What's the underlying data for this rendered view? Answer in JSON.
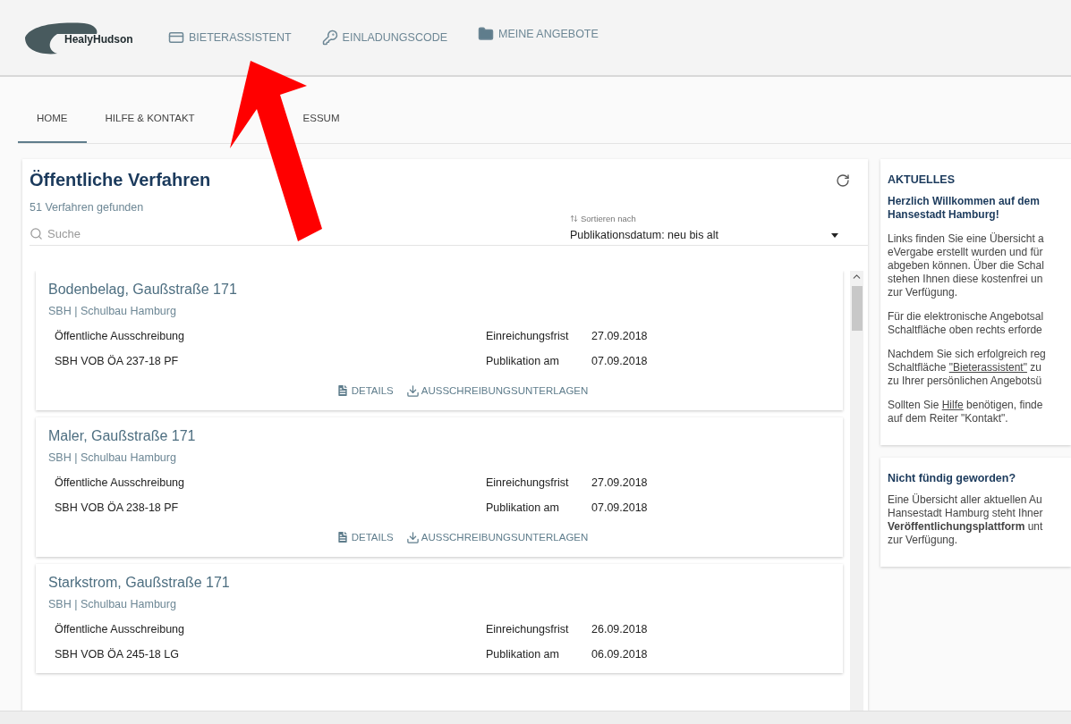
{
  "header": {
    "logo": "HealyHudson",
    "nav": [
      {
        "kind": "assistant",
        "label": "BIETERASSISTENT"
      },
      {
        "kind": "key",
        "label": "EINLADUNGSCODE"
      },
      {
        "kind": "folder",
        "label": "MEINE ANGEBOTE"
      }
    ]
  },
  "tabs": [
    {
      "label": "HOME",
      "selected": true
    },
    {
      "label": "HILFE & KONTAKT",
      "selected": false
    },
    {
      "label": "ESSUM",
      "selected": false
    }
  ],
  "procedures": {
    "title": "Öffentliche Verfahren",
    "count": "51 Verfahren gefunden",
    "search": {
      "placeholder": "Suche"
    },
    "sort": {
      "label": "Sortieren nach",
      "value": "Publikationsdatum: neu bis alt"
    },
    "items": [
      {
        "title": "Bodenbelag, Gaußstraße 171",
        "org": "SBH | Schulbau Hamburg",
        "type": "Öffentliche Ausschreibung",
        "ref": "SBH VOB ÖA 237-18 PF",
        "deadline_label": "Einreichungsfrist",
        "deadline": "27.09.2018",
        "published_label": "Publikation am",
        "published": "07.09.2018",
        "actions": [
          "DETAILS",
          "AUSSCHREIBUNGSUNTERLAGEN"
        ]
      },
      {
        "title": "Maler, Gaußstraße 171",
        "org": "SBH | Schulbau Hamburg",
        "type": "Öffentliche Ausschreibung",
        "ref": "SBH VOB ÖA 238-18 PF",
        "deadline_label": "Einreichungsfrist",
        "deadline": "27.09.2018",
        "published_label": "Publikation am",
        "published": "07.09.2018",
        "actions": [
          "DETAILS",
          "AUSSCHREIBUNGSUNTERLAGEN"
        ]
      },
      {
        "title": "Starkstrom, Gaußstraße 171",
        "org": "SBH | Schulbau Hamburg",
        "type": "Öffentliche Ausschreibung",
        "ref": "SBH VOB ÖA 245-18 LG",
        "deadline_label": "Einreichungsfrist",
        "deadline": "26.09.2018",
        "published_label": "Publikation am",
        "published": "06.09.2018"
      }
    ]
  },
  "news": [
    {
      "title": "AKTUELLES",
      "paragraphs": [
        {
          "kind": "heading",
          "lines": [
            [
              {
                "kind": "text",
                "text": "Herzlich Willkommen auf dem"
              }
            ],
            [
              {
                "kind": "text",
                "text": "Hansestadt Hamburg!"
              }
            ]
          ]
        },
        {
          "kind": "body",
          "lines": [
            [
              {
                "kind": "text",
                "text": "Links finden Sie eine Übersicht a"
              }
            ],
            [
              {
                "kind": "text",
                "text": "eVergabe erstellt wurden und für"
              }
            ],
            [
              {
                "kind": "text",
                "text": "abgeben können. Über die Schal"
              }
            ],
            [
              {
                "kind": "text",
                "text": "stehen Ihnen diese kostenfrei un"
              }
            ],
            [
              {
                "kind": "text",
                "text": "zur Verfügung."
              }
            ]
          ]
        },
        {
          "kind": "body",
          "lines": [
            [
              {
                "kind": "text",
                "text": "Für die elektronische Angebotsal"
              }
            ],
            [
              {
                "kind": "text",
                "text": "Schaltfläche oben rechts erforde"
              }
            ]
          ]
        },
        {
          "kind": "body",
          "lines": [
            [
              {
                "kind": "text",
                "text": "Nachdem Sie sich erfolgreich reg"
              }
            ],
            [
              {
                "kind": "text",
                "text": "Schaltfläche "
              },
              {
                "kind": "link",
                "text": "\"Bieterassistent\""
              },
              {
                "kind": "text",
                "text": " zu"
              }
            ],
            [
              {
                "kind": "text",
                "text": "zu Ihrer persönlichen Angebotsü"
              }
            ]
          ]
        },
        {
          "kind": "body",
          "lines": [
            [
              {
                "kind": "text",
                "text": "Sollten Sie "
              },
              {
                "kind": "link",
                "text": "Hilfe"
              },
              {
                "kind": "text",
                "text": " benötigen, finde"
              }
            ],
            [
              {
                "kind": "text",
                "text": "auf dem Reiter \"Kontakt\"."
              }
            ]
          ]
        }
      ]
    },
    {
      "title": "Nicht fündig geworden?",
      "paragraphs": [
        {
          "kind": "body",
          "lines": [
            [
              {
                "kind": "text",
                "text": "Eine Übersicht aller aktuellen Au"
              }
            ],
            [
              {
                "kind": "text",
                "text": "Hansestadt Hamburg steht Ihner"
              }
            ],
            [
              {
                "kind": "text",
                "text": "**Veröffentlichungsplattform** unt"
              }
            ],
            [
              {
                "kind": "text",
                "text": "zur Verfügung."
              }
            ]
          ]
        }
      ]
    }
  ]
}
